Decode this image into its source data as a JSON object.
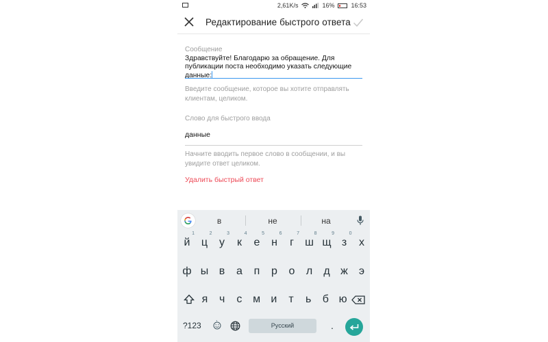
{
  "status_bar": {
    "speed": "2,61K/s",
    "battery": "16%",
    "time": "16:53"
  },
  "toolbar": {
    "title": "Редактирование быстрого ответа"
  },
  "message": {
    "label": "Сообщение",
    "value": "Здравствуйте! Благодарю за обращение. Для публикации поста необходимо указать следующие данные:",
    "hint": "Введите сообщение, которое вы хотите отправлять клиентам, целиком."
  },
  "shortcut": {
    "label": "Слово для быстрого ввода",
    "value": "данные",
    "hint": "Начните вводить первое слово в сообщении, и вы увидите ответ целиком."
  },
  "delete_label": "Удалить быстрый ответ",
  "keyboard": {
    "suggestions": [
      "в",
      "не",
      "на"
    ],
    "row1": [
      "й",
      "ц",
      "у",
      "к",
      "е",
      "н",
      "г",
      "ш",
      "щ",
      "з",
      "х"
    ],
    "row1_hints": [
      "1",
      "2",
      "3",
      "4",
      "5",
      "6",
      "7",
      "8",
      "9",
      "0",
      ""
    ],
    "row2": [
      "ф",
      "ы",
      "в",
      "а",
      "п",
      "р",
      "о",
      "л",
      "д",
      "ж",
      "э"
    ],
    "row3": [
      "я",
      "ч",
      "с",
      "м",
      "и",
      "т",
      "ь",
      "б",
      "ю"
    ],
    "numbers_key": "?123",
    "space_label": "Русский",
    "period_key": ".",
    "comma_hint": ",",
    "colors": {
      "accent": "#26a69a",
      "background": "#eceff1",
      "delete_text": "#ed4956",
      "focus_line": "#3897f0"
    }
  }
}
